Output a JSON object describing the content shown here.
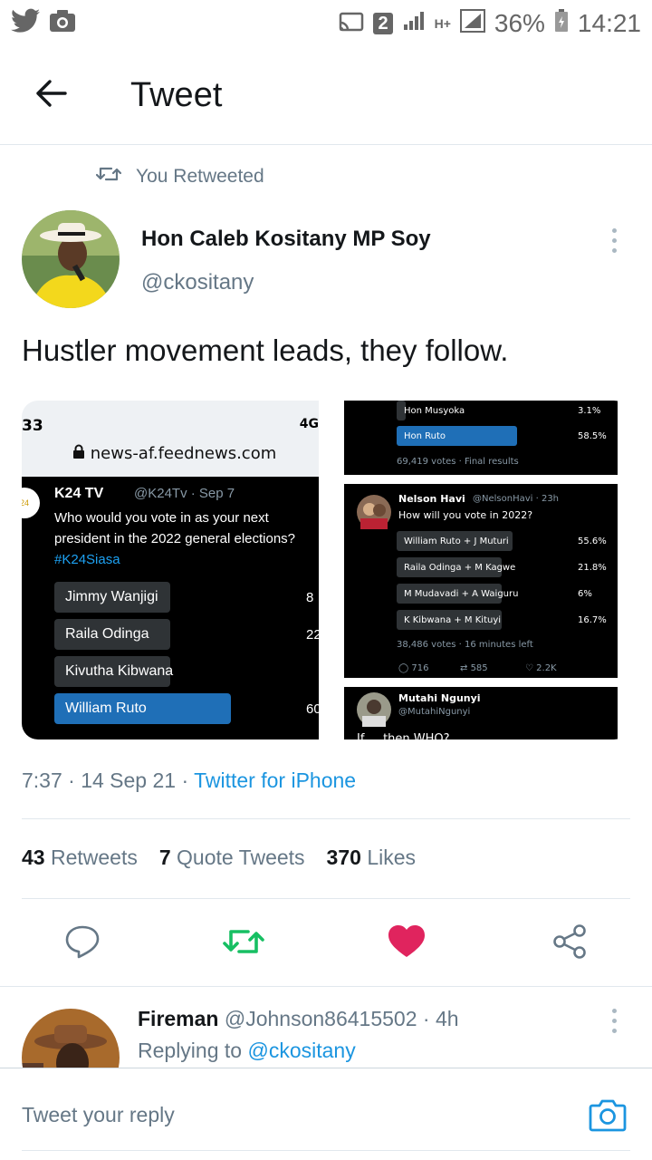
{
  "status_bar": {
    "left_icons": [
      "twitter-icon",
      "camera-icon"
    ],
    "sim_number": "2",
    "network": "H+",
    "battery": "36%",
    "time": "14:21"
  },
  "header": {
    "title": "Tweet",
    "back_icon": "arrow-left-icon"
  },
  "tweet": {
    "retweet_note": "You Retweeted",
    "author_name": "Hon Caleb Kositany MP Soy",
    "author_handle": "@ckositany",
    "text": "Hustler movement leads, they follow.",
    "timestamp": "7:37 · 14 Sep 21 · ",
    "source": "Twitter for iPhone",
    "stats": {
      "retweets_count": "43",
      "retweets_label": "Retweets",
      "quotes_count": "7",
      "quotes_label": "Quote Tweets",
      "likes_count": "370",
      "likes_label": "Likes"
    },
    "liked": true,
    "retweeted": true
  },
  "media_left": {
    "time": "33",
    "signal": "4G",
    "url": "news-af.feednews.com",
    "account_name": "K24 TV",
    "account_meta": "@K24Tv · Sep 7",
    "question_lines": [
      "Who would you vote in as your next",
      "president in the 2022 general elections?"
    ],
    "hashtag": "#K24Siasa",
    "poll": [
      {
        "label": "Jimmy Wanjigi",
        "pct": "8",
        "fill": 0.08,
        "winner": false
      },
      {
        "label": "Raila Odinga",
        "pct": "22",
        "fill": 0.22,
        "winner": false
      },
      {
        "label": "Kivutha Kibwana",
        "pct": "",
        "fill": 0.04,
        "winner": false
      },
      {
        "label": "William Ruto",
        "pct": "60",
        "fill": 0.6,
        "winner": true
      }
    ]
  },
  "media_right": {
    "top_poll": [
      {
        "label": "Hon Musyoka",
        "pct": "3.1%",
        "fill": 0.031,
        "winner": false
      },
      {
        "label": "Hon Ruto",
        "pct": "58.5%",
        "fill": 0.585,
        "winner": true
      }
    ],
    "top_footer": "69,419 votes · Final results",
    "poll2_name": "Nelson Havi",
    "poll2_meta": "@NelsonHavi · 23h",
    "poll2_question": "How will you vote in 2022?",
    "poll2": [
      {
        "label": "William Ruto + J Muturi",
        "pct": "55.6%",
        "fill": 0.556,
        "winner": false
      },
      {
        "label": "Raila Odinga + M Kagwe",
        "pct": "21.8%",
        "fill": 0.218,
        "winner": false
      },
      {
        "label": "M Mudavadi + A Waiguru",
        "pct": "6%",
        "fill": 0.06,
        "winner": false
      },
      {
        "label": "K Kibwana + M Kituyi",
        "pct": "16.7%",
        "fill": 0.167,
        "winner": false
      }
    ],
    "poll2_footer": "38,486 votes · 16 minutes left",
    "poll2_replies": "716",
    "poll2_retweets": "585",
    "poll2_likes": "2.2K",
    "third_name": "Mutahi Ngunyi",
    "third_handle": "@MutahiNgunyi",
    "third_text": "If ... then WHO?"
  },
  "reply": {
    "name": "Fireman",
    "handle": "@Johnson86415502",
    "time": "· 4h",
    "replying_prefix": "Replying to",
    "replying_to": "@ckositany"
  },
  "composer": {
    "placeholder": "Tweet your reply"
  },
  "colors": {
    "accent": "#1b95e0",
    "retweet_green": "#17bf63",
    "like_red": "#e0245e",
    "muted": "#657786"
  }
}
